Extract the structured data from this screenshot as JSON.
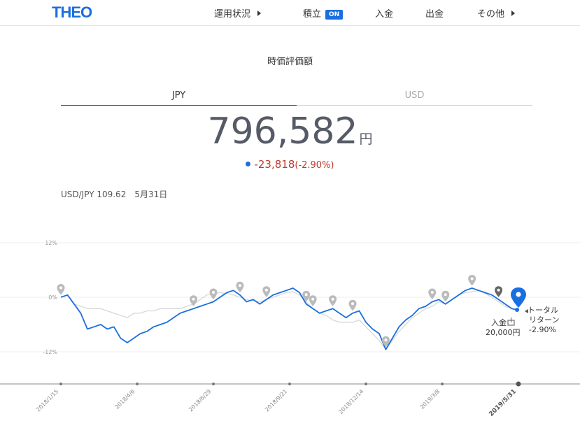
{
  "header": {
    "logo": "THEO",
    "nav": {
      "performance": "運用状況",
      "accumulate": "積立",
      "accumulate_badge": "ON",
      "deposit": "入金",
      "withdraw": "出金",
      "other": "その他"
    }
  },
  "valuation": {
    "title": "時価評価額",
    "tabs": {
      "jpy": "JPY",
      "usd": "USD"
    },
    "amount": "796,582",
    "unit": "円",
    "change": "-23,818",
    "change_pct": "(-2.90%)"
  },
  "fx": {
    "pair_rate": "USD/JPY 109.62",
    "date": "5月31日"
  },
  "colors": {
    "accent": "#1a6fe0",
    "negative": "#c0392b",
    "benchmark": "#d8d8d8"
  },
  "annotations": {
    "total_return_line1": "トータル",
    "total_return_line2": "リターン",
    "total_return_value": "-2.90%",
    "deposit_label": "入金",
    "deposit_amount": "20,000円"
  },
  "chart_data": {
    "type": "line",
    "y_ticks": [
      "12%",
      "0%",
      "-12%"
    ],
    "x_ticks": [
      "2018/1/15",
      "2018/4/6",
      "2018/6/29",
      "2018/9/21",
      "2018/12/14",
      "2019/3/8",
      "2019/5/31"
    ],
    "ylim": [
      -12,
      12
    ],
    "series": [
      {
        "role": "portfolio",
        "values": [
          0.0,
          0.5,
          -1.5,
          -3.5,
          -7.0,
          -6.5,
          -6.0,
          -7.0,
          -6.5,
          -9.0,
          -10.0,
          -9.0,
          -8.0,
          -7.5,
          -6.5,
          -6.0,
          -5.5,
          -4.5,
          -3.5,
          -3.0,
          -2.5,
          -2.0,
          -1.5,
          -1.0,
          0.0,
          1.0,
          1.5,
          0.5,
          -1.0,
          -0.5,
          -1.5,
          -0.5,
          0.5,
          1.0,
          1.5,
          2.0,
          1.0,
          -1.5,
          -2.5,
          -3.5,
          -3.0,
          -2.5,
          -3.5,
          -4.5,
          -3.5,
          -3.0,
          -5.5,
          -7.0,
          -8.0,
          -11.5,
          -9.0,
          -6.5,
          -5.0,
          -4.0,
          -2.5,
          -2.0,
          -1.0,
          -0.5,
          -1.5,
          -0.5,
          0.5,
          1.5,
          2.0,
          1.5,
          1.0,
          0.5,
          -0.5,
          -1.5,
          -2.5,
          -2.9
        ]
      },
      {
        "role": "benchmark",
        "values": [
          0.0,
          0.5,
          -1.5,
          -2.0,
          -2.5,
          -2.5,
          -2.5,
          -3.0,
          -3.5,
          -4.0,
          -4.5,
          -3.5,
          -3.5,
          -3.0,
          -3.0,
          -2.5,
          -2.5,
          -2.5,
          -2.5,
          -2.0,
          -1.5,
          -0.5,
          0.5,
          0.8,
          1.0,
          0.8,
          0.5,
          0.0,
          -0.5,
          -0.8,
          -1.0,
          -0.5,
          0.0,
          0.5,
          1.0,
          1.2,
          0.5,
          -1.0,
          -2.5,
          -3.5,
          -4.0,
          -5.0,
          -5.5,
          -5.5,
          -5.5,
          -5.0,
          -6.5,
          -8.0,
          -9.5,
          -11.5,
          -9.5,
          -7.5,
          -6.0,
          -4.5,
          -3.5,
          -2.5,
          -2.0,
          -1.0,
          -1.5,
          -0.5,
          0.5,
          1.0,
          1.2,
          1.5,
          0.8,
          0.0,
          -1.0,
          -2.0,
          -2.5,
          -2.9
        ]
      }
    ]
  }
}
